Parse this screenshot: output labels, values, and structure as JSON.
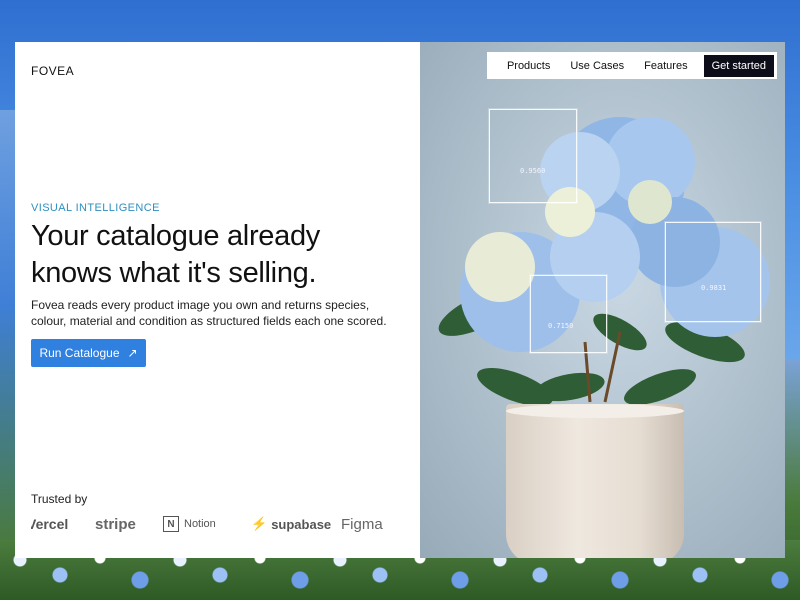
{
  "brand": {
    "name": "FOVEA"
  },
  "nav": {
    "items": [
      "Products",
      "Use Cases",
      "Features"
    ],
    "cta": "Get started"
  },
  "hero": {
    "eyebrow": "VISUAL INTELLIGENCE",
    "headline_line1": "Your catalogue already",
    "headline_line2": "knows what it's selling.",
    "description": "Fovea reads every product image you own and returns species, colour, material and condition as structured fields each one scored.",
    "cta_label": "Run Catalogue",
    "cta_icon": "arrow-up-right-icon"
  },
  "trusted": {
    "label": "Trusted by",
    "logos": [
      "Vercel",
      "stripe",
      "Notion",
      "supabase",
      "Figma"
    ]
  },
  "detections": [
    {
      "score": "0.9560"
    },
    {
      "score": "0.9831"
    },
    {
      "score": "0.7150"
    }
  ],
  "colors": {
    "accent": "#2f80df",
    "eyebrow": "#2e8fbf",
    "nav_cta_bg": "#0d0d1a"
  }
}
